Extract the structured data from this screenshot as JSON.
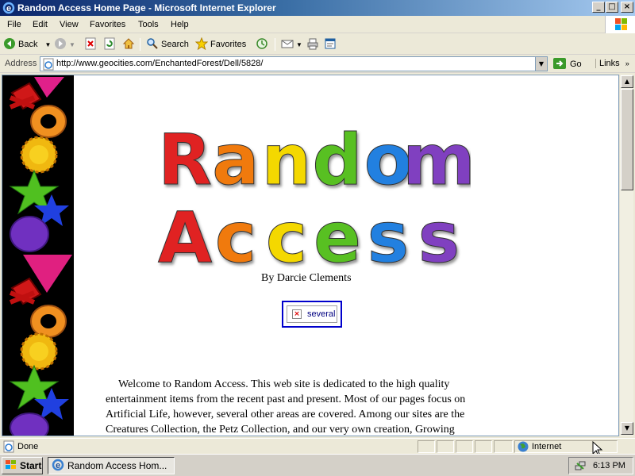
{
  "window": {
    "title": "Random Access Home Page - Microsoft Internet Explorer",
    "controls": {
      "minimize": "_",
      "maximize": "□",
      "close": "×"
    }
  },
  "menu": [
    "File",
    "Edit",
    "View",
    "Favorites",
    "Tools",
    "Help"
  ],
  "toolbar": {
    "back_label": "Back",
    "search_label": "Search",
    "favorites_label": "Favorites"
  },
  "address": {
    "label": "Address",
    "url": "http://www.geocities.com/EnchantedForest/Dell/5828/",
    "go_label": "Go",
    "links_label": "Links"
  },
  "page": {
    "logo_line1": "Random",
    "logo_line2": "Access",
    "byline": "By Darcie Clements",
    "broken_image_alt": "several",
    "intro": "Welcome to Random Access.  This web site is dedicated to the high quality entertainment items from the recent past and present.  Most of our pages focus on Artificial Life, however, several other areas are covered.  Among our sites are the Creatures Collection, the Petz Collection, and our very own creation, Growing"
  },
  "status": {
    "text": "Done",
    "zone": "Internet"
  },
  "taskbar": {
    "start_label": "Start",
    "task_label": "Random Access Hom...",
    "clock": "6:13 PM"
  },
  "colors": {
    "logo": [
      "#e02020",
      "#f07a10",
      "#f4d800",
      "#58c020",
      "#2080e0",
      "#8040c0"
    ]
  }
}
